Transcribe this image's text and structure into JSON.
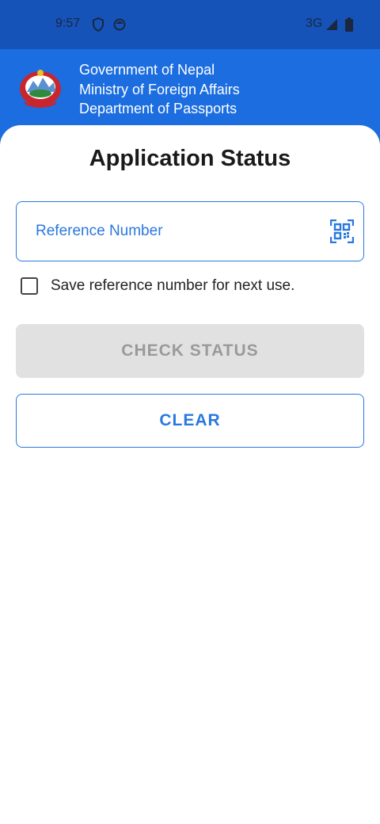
{
  "status_bar": {
    "time": "9:57",
    "network": "3G",
    "icons": [
      "shield-icon",
      "circle-icon",
      "signal-icon",
      "battery-icon"
    ]
  },
  "header": {
    "line1": "Government of Nepal",
    "line2": "Ministry of Foreign Affairs",
    "line3": "Department of Passports",
    "emblem": "nepal-emblem-icon"
  },
  "main": {
    "title": "Application Status",
    "reference_field": {
      "placeholder": "Reference Number",
      "value": "",
      "icon": "qr-scan-icon"
    },
    "save_checkbox": {
      "label": "Save reference number for next use.",
      "checked": false
    },
    "check_button": "CHECK STATUS",
    "clear_button": "CLEAR"
  },
  "colors": {
    "status_bar_bg": "#1653b8",
    "header_bg": "#1b6de0",
    "accent": "#2a78de",
    "disabled_bg": "#e1e1e1",
    "disabled_text": "#9a9a9a"
  }
}
